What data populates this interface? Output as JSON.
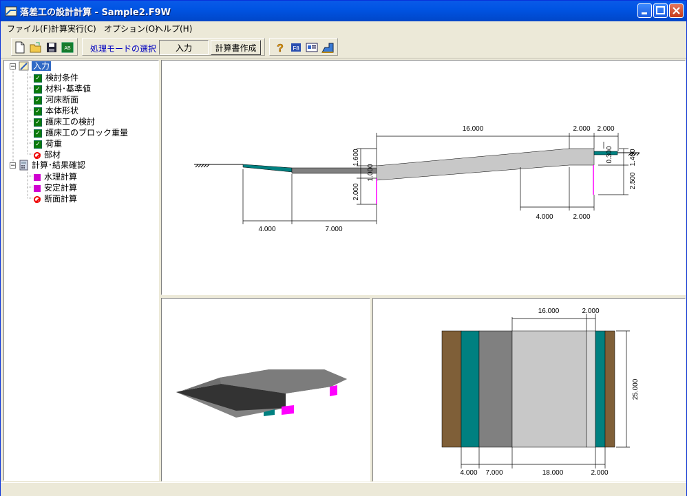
{
  "window": {
    "title": "落差工の設計計算 - Sample2.F9W"
  },
  "menu": {
    "items": [
      "ファイル(F)",
      "計算実行(C)",
      "オプション(O)",
      "ヘルプ(H)"
    ]
  },
  "toolbar": {
    "mode_label": "処理モードの選択",
    "mode_value": "入力",
    "report_button": "計算書作成"
  },
  "tree": {
    "input_root": "入力",
    "input_items": [
      {
        "label": "検討条件",
        "status": "checked"
      },
      {
        "label": "材料･基準値",
        "status": "checked"
      },
      {
        "label": "河床断面",
        "status": "checked"
      },
      {
        "label": "本体形状",
        "status": "checked"
      },
      {
        "label": "護床工の検討",
        "status": "checked"
      },
      {
        "label": "護床工のブロック重量",
        "status": "checked"
      },
      {
        "label": "荷重",
        "status": "checked"
      },
      {
        "label": "部材",
        "status": "disabled"
      }
    ],
    "calc_root": "計算･結果確認",
    "calc_items": [
      {
        "label": "水理計算",
        "status": "pending"
      },
      {
        "label": "安定計算",
        "status": "pending"
      },
      {
        "label": "断面計算",
        "status": "disabled"
      }
    ]
  },
  "section_view": {
    "dims": {
      "top_16": "16.000",
      "top_2a": "2.000",
      "top_2b": "2.000",
      "v_1600": "1.600",
      "v_1000": "1.000",
      "v_2000": "2.000",
      "v_0300": "0.300",
      "v_1400": "1.400",
      "v_2500": "2.500",
      "bot_4": "4.000",
      "bot_7": "7.000",
      "bot_4r": "4.000",
      "bot_2r": "2.000"
    }
  },
  "plan_view": {
    "dims": {
      "top_16": "16.000",
      "top_2": "2.000",
      "side_25": "25.000",
      "bot_4": "4.000",
      "bot_7": "7.000",
      "bot_18": "18.000",
      "bot_2": "2.000"
    }
  },
  "colors": {
    "teal": "#008080",
    "brown": "#7f5f38",
    "dark_gray": "#808080",
    "light_gray": "#c0c0c0",
    "magenta": "#ff00ff"
  }
}
